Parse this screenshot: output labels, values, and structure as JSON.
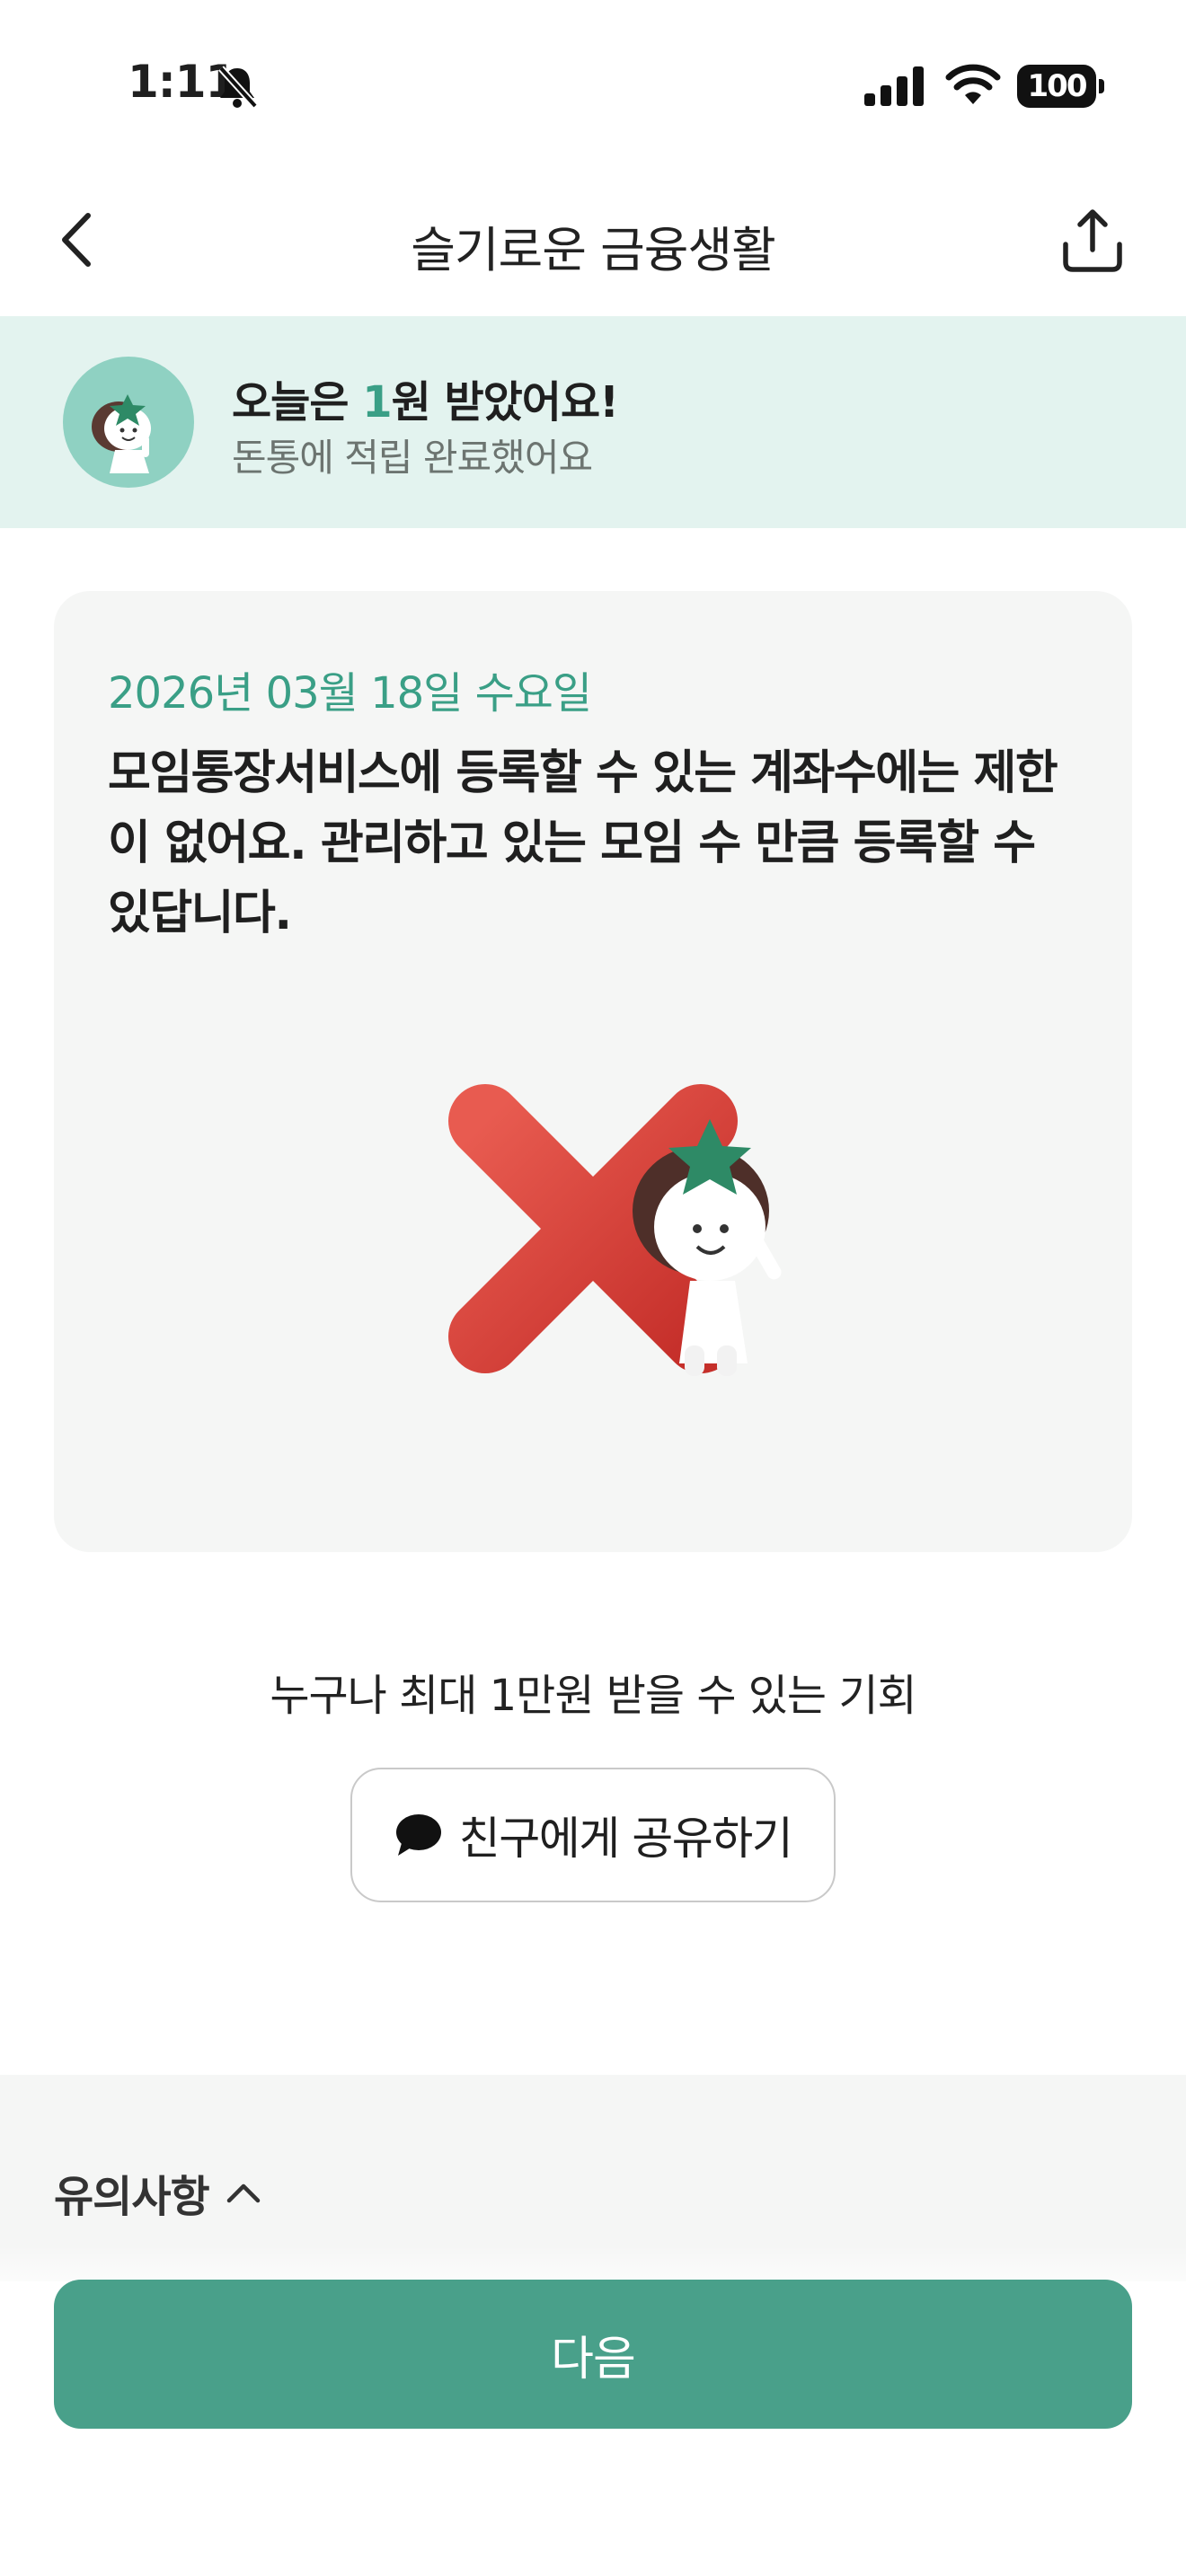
{
  "status_bar": {
    "time": "1:11",
    "battery": "100",
    "icons": [
      "bell-muted-icon",
      "signal-icon",
      "wifi-icon",
      "battery-icon"
    ]
  },
  "nav": {
    "title": "슬기로운 금융생활",
    "back_icon": "chevron-left-icon",
    "share_icon": "share-upload-icon"
  },
  "reward_banner": {
    "title_prefix": "오늘은 ",
    "amount": "1",
    "title_suffix": "원 받았어요!",
    "subtitle": "돈통에 적립 완료했어요"
  },
  "quiz": {
    "date": "2026년 03월 18일 수요일",
    "text": "모임통장서비스에 등록할 수 있는 계좌수에는 제한이 없어요. 관리하고 있는 모임 수 만큼 등록할 수 있답니다.",
    "illustration": "x-mark-with-character"
  },
  "share": {
    "caption": "누구나 최대 1만원 받을 수 있는 기회",
    "button_label": "친구에게 공유하기",
    "icon": "chat-bubble-icon"
  },
  "notice": {
    "label": "유의사항",
    "icon": "chevron-up-icon"
  },
  "next_button": {
    "label": "다음"
  },
  "colors": {
    "accent": "#49a08a",
    "accent_text": "#3a9f86",
    "banner_bg": "#e3f3ef",
    "card_bg": "#f5f6f5",
    "x_mark": "#d63a33"
  }
}
